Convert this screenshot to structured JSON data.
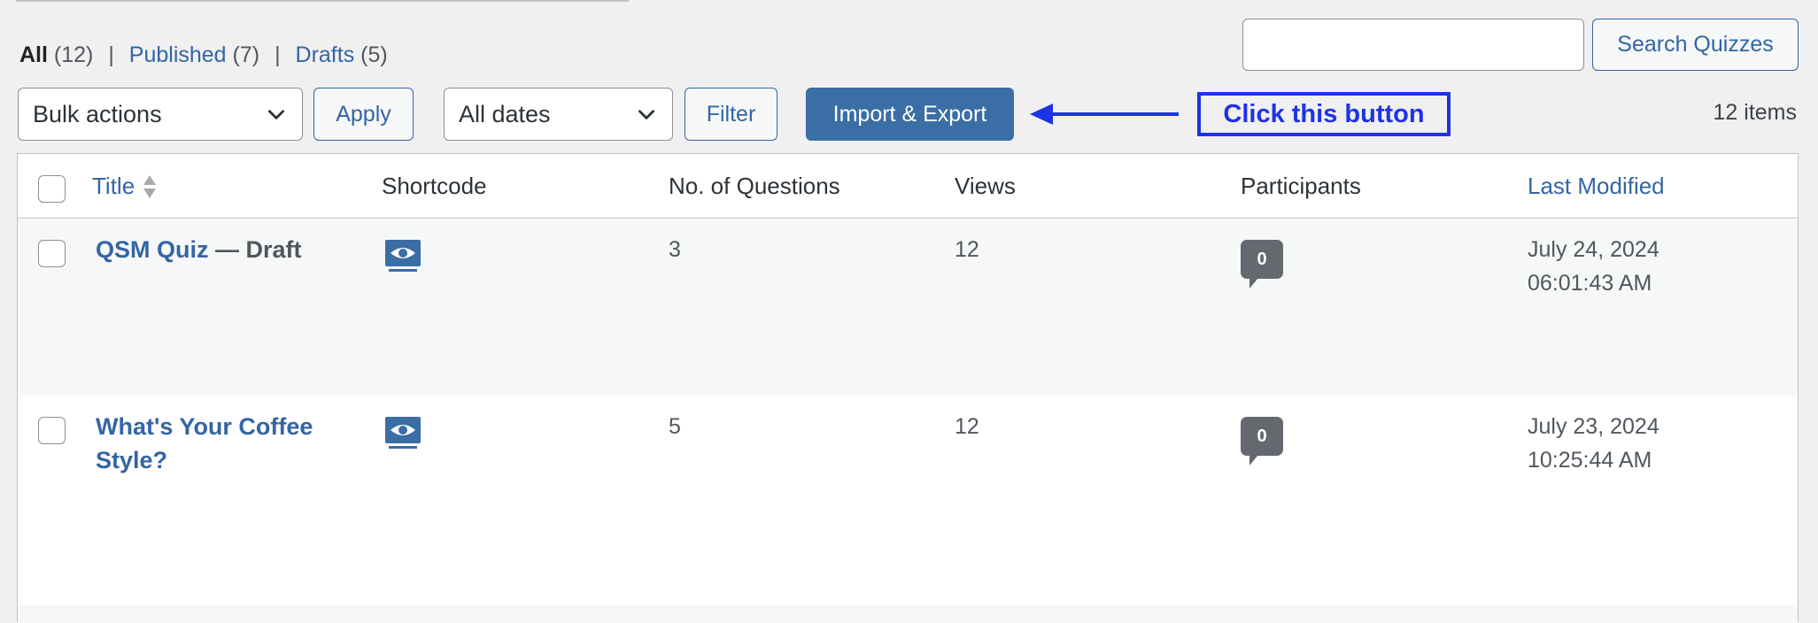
{
  "filters": {
    "all": {
      "label": "All",
      "count": "(12)"
    },
    "published": {
      "label": "Published",
      "count": "(7)"
    },
    "drafts": {
      "label": "Drafts",
      "count": "(5)"
    },
    "separator": "|"
  },
  "search": {
    "input_value": "",
    "placeholder": "",
    "button_label": "Search Quizzes"
  },
  "toolbar": {
    "bulk_actions_selected": "Bulk actions",
    "apply_label": "Apply",
    "dates_selected": "All dates",
    "filter_label": "Filter",
    "import_export_label": "Import & Export",
    "items_count": "12 items"
  },
  "annotation": {
    "callout_text": "Click this button",
    "color": "#1e32e6"
  },
  "table": {
    "columns": [
      {
        "key": "title",
        "label": "Title",
        "sortable": true
      },
      {
        "key": "shortcode",
        "label": "Shortcode"
      },
      {
        "key": "questions",
        "label": "No. of Questions"
      },
      {
        "key": "views",
        "label": "Views"
      },
      {
        "key": "participants",
        "label": "Participants"
      },
      {
        "key": "last_modified",
        "label": "Last Modified",
        "sortable": true
      }
    ],
    "rows": [
      {
        "title": "QSM Quiz",
        "state": " — Draft",
        "shortcode_icon": "shortcode-preview-icon",
        "questions": "3",
        "views": "12",
        "participants": "0",
        "date": "July 24, 2024",
        "time": "06:01:43 AM"
      },
      {
        "title": "What's Your Coffee Style?",
        "state": "",
        "shortcode_icon": "shortcode-preview-icon",
        "questions": "5",
        "views": "12",
        "participants": "0",
        "date": "July 23, 2024",
        "time": "10:25:44 AM"
      }
    ]
  },
  "colors": {
    "link": "#3465a4",
    "primary_button": "#3a6ea5",
    "badge": "#646970",
    "background": "#f0f0f1"
  }
}
